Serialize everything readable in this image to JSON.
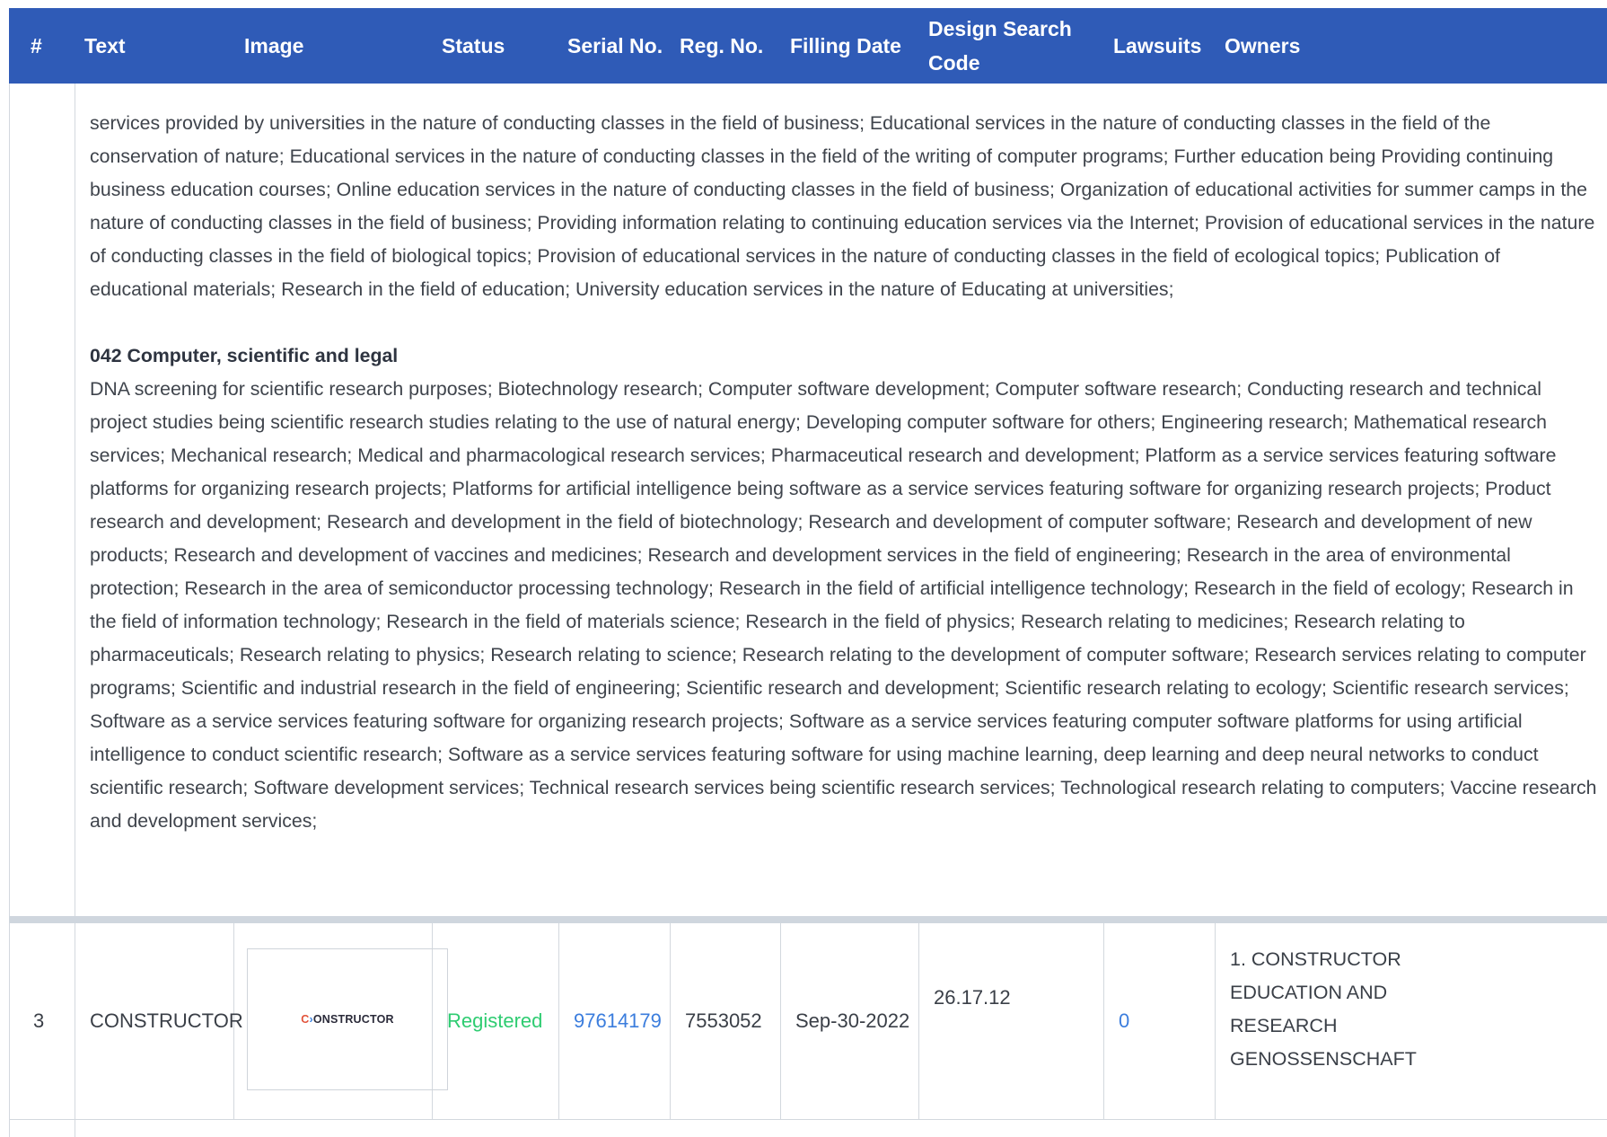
{
  "header": {
    "num": "#",
    "text": "Text",
    "image": "Image",
    "status": "Status",
    "serial": "Serial No.",
    "reg": "Reg. No.",
    "filing_date": "Filling Date",
    "design_code_line1": "Design Search",
    "design_code_line2": "Code",
    "lawsuits": "Lawsuits",
    "owners": "Owners"
  },
  "description": {
    "continuation": "services provided by universities in the nature of conducting classes in the field of business; Educational services in the nature of conducting classes in the field of the conservation of nature; Educational services in the nature of conducting classes in the field of the writing of computer programs; Further education being Providing continuing business education courses; Online education services in the nature of conducting classes in the field of business; Organization of educational activities for summer camps in the nature of conducting classes in the field of business; Providing information relating to continuing education services via the Internet; Provision of educational services in the nature of conducting classes in the field of biological topics; Provision of educational services in the nature of conducting classes in the field of ecological topics; Publication of educational materials; Research in the field of education; University education services in the nature of Educating at universities;",
    "class_title": "042 Computer, scientific and legal",
    "class_text": "DNA screening for scientific research purposes; Biotechnology research; Computer software development; Computer software research; Conducting research and technical project studies being scientific research studies relating to the use of natural energy; Developing computer software for others; Engineering research; Mathematical research services; Mechanical research; Medical and pharmacological research services; Pharmaceutical research and development; Platform as a service services featuring software platforms for organizing research projects; Platforms for artificial intelligence being software as a service services featuring software for organizing research projects; Product research and development; Research and development in the field of biotechnology; Research and development of computer software; Research and development of new products; Research and development of vaccines and medicines; Research and development services in the field of engineering; Research in the area of environmental protection; Research in the area of semiconductor processing technology; Research in the field of artificial intelligence technology; Research in the field of ecology; Research in the field of information technology; Research in the field of materials science; Research in the field of physics; Research relating to medicines; Research relating to pharmaceuticals; Research relating to physics; Research relating to science; Research relating to the development of computer software; Research services relating to computer programs; Scientific and industrial research in the field of engineering; Scientific research and development; Scientific research relating to ecology; Scientific research services; Software as a service services featuring software for organizing research projects; Software as a service services featuring computer software platforms for using artificial intelligence to conduct scientific research; Software as a service services featuring software for using machine learning, deep learning and deep neural networks to conduct scientific research; Software development services; Technical research services being scientific research services; Technological research relating to computers; Vaccine research and development services;"
  },
  "row": {
    "num": "3",
    "text": "CONSTRUCTOR",
    "logo_text": "CONSTRUCTOR",
    "status": "Registered",
    "serial": "97614179",
    "reg": "7553052",
    "filing_date": "Sep-30-2022",
    "design_code": "26.17.12",
    "lawsuits": "0",
    "owners": "1. CONSTRUCTOR EDUCATION AND RESEARCH GENOSSENSCHAFT"
  },
  "colors": {
    "header_bg": "#2f5bb7",
    "status_registered": "#2ecc71",
    "link": "#3b7ddd"
  }
}
